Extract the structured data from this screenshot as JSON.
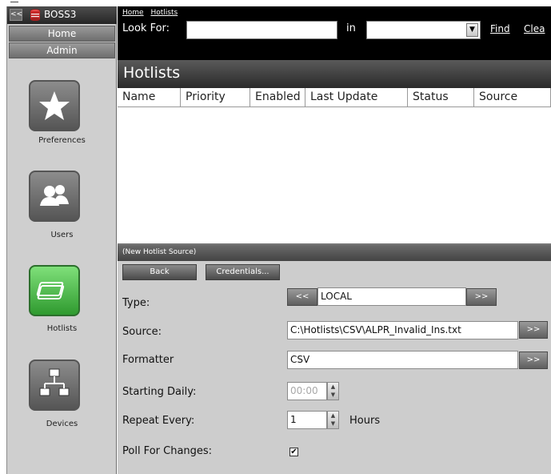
{
  "sidebar": {
    "collapse_label": "<<",
    "app_name": "BOSS3",
    "nav": [
      {
        "label": "Home"
      },
      {
        "label": "Admin"
      }
    ],
    "tiles": [
      {
        "label": "Preferences",
        "icon": "star-icon",
        "active": false
      },
      {
        "label": "Users",
        "icon": "users-icon",
        "active": false
      },
      {
        "label": "Hotlists",
        "icon": "cards-icon",
        "active": true
      },
      {
        "label": "Devices",
        "icon": "network-icon",
        "active": false
      }
    ]
  },
  "header": {
    "breadcrumb": [
      "Home",
      "Hotlists"
    ],
    "look_for_label": "Look For:",
    "look_for_value": "",
    "in_label": "in",
    "in_value": "",
    "find_label": "Find",
    "clear_label": "Clea"
  },
  "list": {
    "title": "Hotlists",
    "columns": [
      "Name",
      "Priority",
      "Enabled",
      "Last Update",
      "Status",
      "Source"
    ],
    "rows": []
  },
  "detail": {
    "title": "(New Hotlist Source)",
    "back_label": "Back",
    "credentials_label": "Credentials...",
    "fields": {
      "type_label": "Type:",
      "type_prev": "<<",
      "type_value": "LOCAL",
      "type_next": ">>",
      "source_label": "Source:",
      "source_value": "C:\\Hotlists\\CSV\\ALPR_Invalid_Ins.txt",
      "source_browse": ">>",
      "formatter_label": "Formatter",
      "formatter_value": "CSV",
      "formatter_browse": ">>",
      "starting_label": "Starting Daily:",
      "starting_value": "00:00",
      "repeat_label": "Repeat Every:",
      "repeat_value": "1",
      "repeat_unit": "Hours",
      "poll_label": "Poll For Changes:",
      "poll_checked": "✔"
    }
  },
  "colors": {
    "dark_bar": "#000000",
    "panel_gray": "#cdcdcd",
    "active_tile": "#3fb53a"
  }
}
